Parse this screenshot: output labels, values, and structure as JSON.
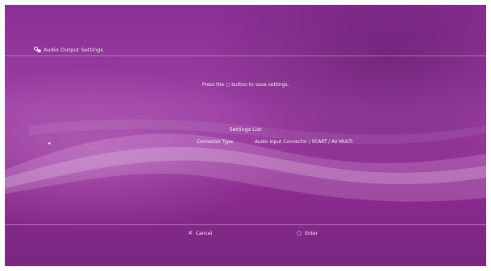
{
  "header": {
    "icon": "audio-settings-icon",
    "title": "Audio Output Settings"
  },
  "hint": "Press the ○ button to save settings.",
  "settings": {
    "title": "Settings List",
    "bullet": "◂",
    "rows": [
      {
        "label": "Connector Type",
        "value": "Audio Input Connector / SCART / AV MULTI"
      }
    ]
  },
  "footer": {
    "cancel_glyph": "✕",
    "cancel_label": "Cancel",
    "enter_glyph": "○",
    "enter_label": "Enter"
  },
  "colors": {
    "background": "#8a2f93",
    "text": "#ffffff"
  }
}
